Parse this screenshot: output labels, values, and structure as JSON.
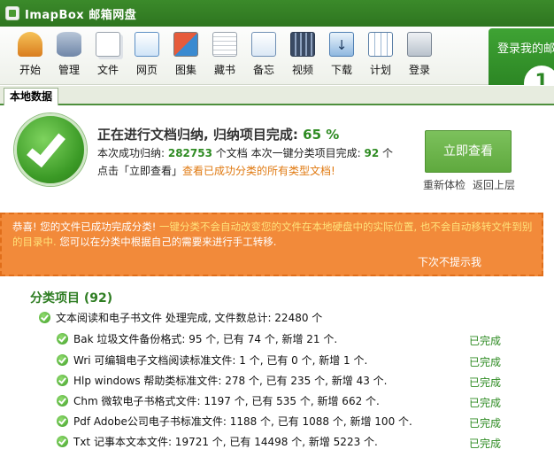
{
  "window": {
    "title": "ImapBox 邮箱网盘"
  },
  "toolbar": {
    "items": [
      {
        "label": "开始"
      },
      {
        "label": "管理"
      },
      {
        "label": "文件"
      },
      {
        "label": "网页"
      },
      {
        "label": "图集"
      },
      {
        "label": "藏书"
      },
      {
        "label": "备忘"
      },
      {
        "label": "视频"
      },
      {
        "label": "下载"
      },
      {
        "label": "计划"
      },
      {
        "label": "登录"
      }
    ]
  },
  "promo": {
    "label": "登录我的邮",
    "number": "1"
  },
  "tabs": {
    "active": "本地数据"
  },
  "status": {
    "title_prefix": "正在进行文档归纳, 归纳项目完成: ",
    "percent": "65",
    "percent_sign": " %",
    "line1_a": "本次成功归纳: ",
    "line1_count": "282753",
    "line1_b": " 个文档  本次一键分类项目完成: ",
    "line1_items": "92",
    "line1_c": " 个",
    "line2_a": "点击「立即查看」",
    "line2_b": "查看已成功分类的所有类型文档!",
    "view_button": "立即查看",
    "recheck": "重新体检",
    "back": "返回上层"
  },
  "notice": {
    "part1": "恭喜! 您的文件已成功完成分类!",
    "part2": "一键分类不会自动改变您的文件在本地硬盘中的实际位置, 也不会自动移转文件到别的目录中.",
    "part3": "您可以在分类中根据自己的需要来进行手工转移.",
    "dismiss": "下次不提示我"
  },
  "categories": {
    "header": "分类项目 (92)",
    "group": "文本阅读和电子书文件 处理完成, 文件数总计: 22480 个",
    "done_label": "已完成",
    "items": [
      {
        "text": "Bak 垃圾文件备份格式: 95 个, 已有 74 个, 新增 21 个."
      },
      {
        "text": "Wri 可编辑电子文档阅读标准文件: 1 个, 已有 0 个, 新增 1 个."
      },
      {
        "text": "Hlp windows 帮助类标准文件: 278 个, 已有 235 个, 新增 43 个."
      },
      {
        "text": "Chm 微软电子书格式文件: 1197 个, 已有 535 个, 新增 662 个."
      },
      {
        "text": "Pdf Adobe公司电子书标准文件: 1188 个, 已有 1088 个, 新增 100 个."
      },
      {
        "text": "Txt 记事本文本文件: 19721 个, 已有 14498 个, 新增 5223 个."
      }
    ]
  },
  "colors": {
    "accent_green": "#2e8b22",
    "notice_orange": "#f28a3a",
    "title_bar": "#3b8a2a"
  }
}
